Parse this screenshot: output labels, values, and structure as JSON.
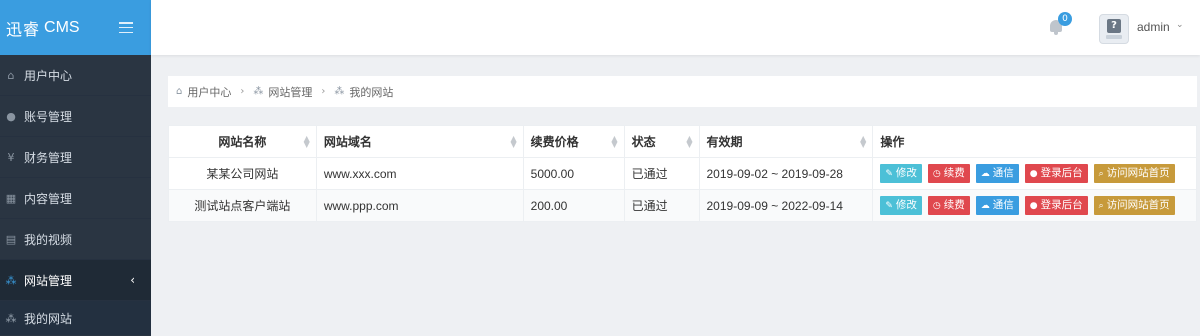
{
  "brand": {
    "name": "迅睿",
    "suffix": "CMS"
  },
  "sidebar": {
    "items": [
      {
        "label": "用户中心",
        "icon": "home-icon"
      },
      {
        "label": "账号管理",
        "icon": "user-icon"
      },
      {
        "label": "财务管理",
        "icon": "yen-icon"
      },
      {
        "label": "内容管理",
        "icon": "grid-icon"
      },
      {
        "label": "我的视频",
        "icon": "file-icon"
      },
      {
        "label": "网站管理",
        "icon": "sitemap-icon",
        "active": true
      }
    ],
    "sub_items": [
      {
        "label": "我的网站",
        "icon": "sitemap-icon"
      }
    ]
  },
  "header": {
    "notification_count": "0",
    "username": "admin"
  },
  "breadcrumb": [
    "用户中心",
    "网站管理",
    "我的网站"
  ],
  "table": {
    "columns": [
      "网站名称",
      "网站域名",
      "续费价格",
      "状态",
      "有效期",
      "操作"
    ],
    "rows": [
      {
        "name": "某某公司网站",
        "domain": "www.xxx.com",
        "price": "5000.00",
        "status": "已通过",
        "period": "2019-09-02 ~ 2019-09-28"
      },
      {
        "name": "测试站点客户端站",
        "domain": "www.ppp.com",
        "price": "200.00",
        "status": "已通过",
        "period": "2019-09-09 ~ 2022-09-14"
      }
    ],
    "actions": [
      "修改",
      "续费",
      "通信",
      "登录后台",
      "访问网站首页"
    ]
  },
  "colors": {
    "accent": "#3a9de0",
    "sidebar_bg": "#2a3542",
    "edit": "#4cc0d7",
    "danger": "#e0484e",
    "visit": "#c79a3b"
  }
}
